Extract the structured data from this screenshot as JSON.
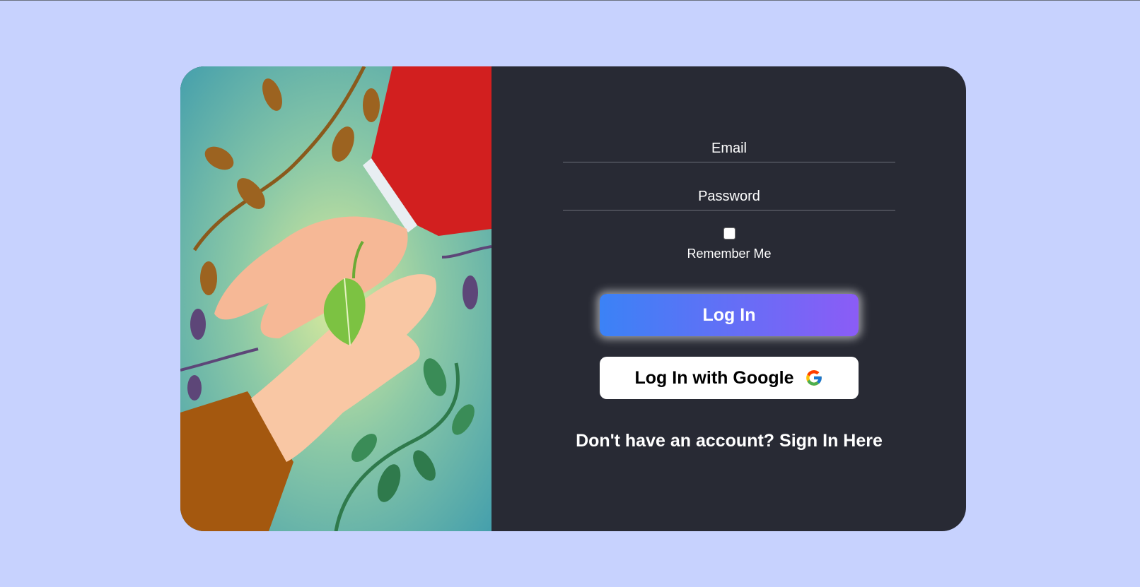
{
  "login_form": {
    "email_placeholder": "Email",
    "password_placeholder": "Password",
    "remember_label": "Remember Me",
    "login_button": "Log In",
    "google_button": "Log In with Google",
    "signup_text": "Don't have an account? Sign In Here"
  },
  "colors": {
    "page_background": "#c7d2fe",
    "panel_background": "#282a34",
    "login_gradient_start": "#3b82f6",
    "login_gradient_end": "#8b5cf6"
  },
  "icons": {
    "google": "google-g-icon"
  }
}
